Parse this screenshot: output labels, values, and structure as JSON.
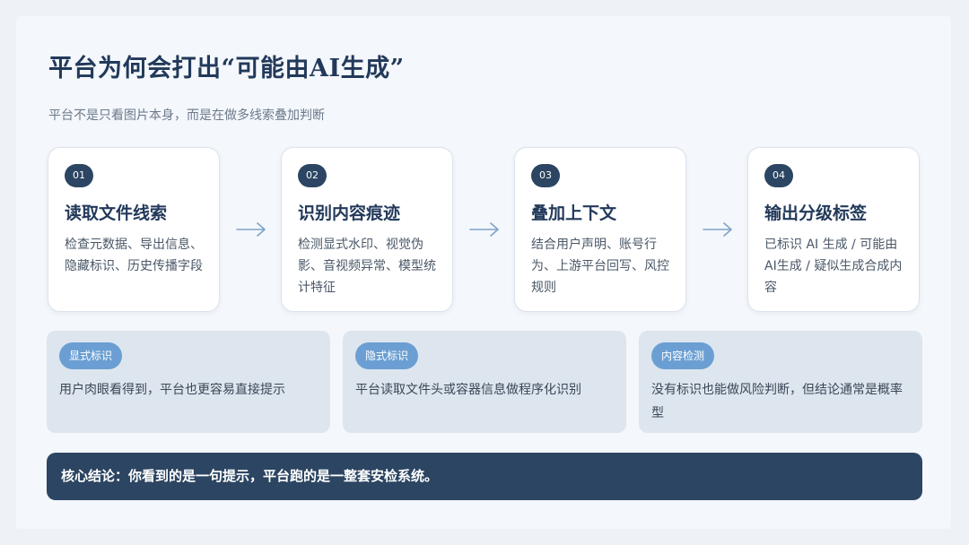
{
  "title": "平台为何会打出“可能由AI生成”",
  "subtitle": "平台不是只看图片本身，而是在做多线索叠加判断",
  "steps": [
    {
      "num": "01",
      "title": "读取文件线索",
      "desc": "检查元数据、导出信息、隐藏标识、历史传播字段"
    },
    {
      "num": "02",
      "title": "识别内容痕迹",
      "desc": "检测显式水印、视觉伪影、音视频异常、模型统计特征"
    },
    {
      "num": "03",
      "title": "叠加上下文",
      "desc": "结合用户声明、账号行为、上游平台回写、风控规则"
    },
    {
      "num": "04",
      "title": "输出分级标签",
      "desc": "已标识 AI 生成 / 可能由AI生成 / 疑似生成合成内容"
    }
  ],
  "categories": [
    {
      "label": "显式标识",
      "desc": "用户肉眼看得到，平台也更容易直接提示"
    },
    {
      "label": "隐式标识",
      "desc": "平台读取文件头或容器信息做程序化识别"
    },
    {
      "label": "内容检测",
      "desc": "没有标识也能做风险判断，但结论通常是概率型"
    }
  ],
  "conclusion": "核心结论：你看到的是一句提示，平台跑的是一整套安检系统。",
  "icons": {
    "arrow": "arrow-right-icon"
  },
  "colors": {
    "accent": "#2b4563",
    "pill": "#6b9fd3",
    "arrow": "#7fa3c9"
  }
}
